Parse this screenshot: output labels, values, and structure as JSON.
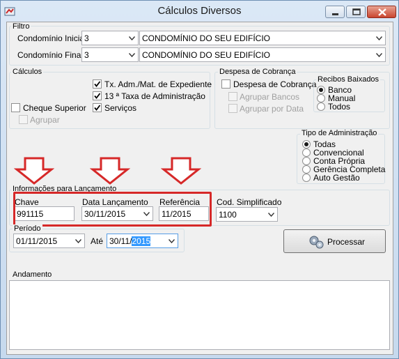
{
  "window": {
    "title": "Cálculos Diversos"
  },
  "filtro": {
    "label": "Filtro",
    "condominio_inicial": {
      "label": "Condomínio Inicial",
      "code": "3",
      "name": "CONDOMÍNIO DO SEU EDIFÍCIO"
    },
    "condominio_final": {
      "label": "Condomínio Final",
      "code": "3",
      "name": "CONDOMÍNIO DO SEU EDIFÍCIO"
    }
  },
  "calculos": {
    "label": "Cálculos",
    "tx_adm": "Tx. Adm./Mat. de Expediente",
    "taxa_13": "13 ª Taxa de Administração",
    "servicos": "Serviços",
    "cheque_superior": "Cheque Superior",
    "agrupar": "Agrupar"
  },
  "despesa": {
    "label": "Despesa de Cobrança",
    "checkbox": "Despesa de Cobrança",
    "agrupar_bancos": "Agrupar Bancos",
    "agrupar_por_data": "Agrupar por Data"
  },
  "recibos": {
    "label": "Recibos Baixados",
    "options": [
      "Banco",
      "Manual",
      "Todos"
    ],
    "selected": "Banco"
  },
  "tipo_admin": {
    "label": "Tipo de Administração",
    "options": [
      "Todas",
      "Convencional",
      "Conta Própria",
      "Gerência Completa",
      "Auto Gestão"
    ],
    "selected": "Todas"
  },
  "lancamento": {
    "label": "Informações para Lançamento",
    "chave_label": "Chave",
    "chave_value": "991115",
    "data_label": "Data Lançamento",
    "data_value": "30/11/2015",
    "referencia_label": "Referência",
    "referencia_value": "11/2015",
    "cod_label": "Cod. Simplificado",
    "cod_value": "1100"
  },
  "periodo": {
    "label": "Período",
    "inicio": "01/11/2015",
    "ate_label": "Até",
    "fim_prefix": "30/11/",
    "fim_selected": "2015"
  },
  "processar": {
    "label": "Processar"
  },
  "andamento": {
    "label": "Andamento"
  },
  "colors": {
    "highlight": "#d62828",
    "selection": "#3399ff",
    "window_frame": "#c6d9ee"
  }
}
